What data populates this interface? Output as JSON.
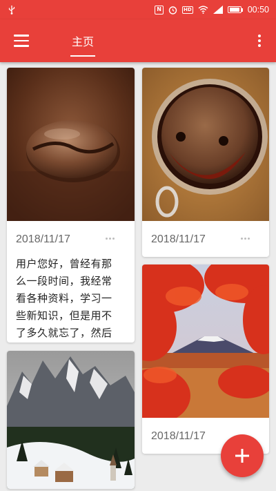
{
  "status_bar": {
    "time": "00:50",
    "icons": [
      "usb-icon",
      "nfc-icon",
      "alarm-icon",
      "hd-icon",
      "wifi-icon",
      "signal-icon",
      "battery-icon"
    ]
  },
  "toolbar": {
    "menu_icon": "hamburger-menu-icon",
    "tab_home": "主页",
    "more_icon": "more-vertical-icon"
  },
  "colors": {
    "primary": "#e8403a",
    "background": "#ececec",
    "card": "#ffffff",
    "date_text": "#666666"
  },
  "cards": [
    {
      "image": "coffee-bean-photo",
      "date": "2018/11/17",
      "more_icon": "more-horizontal-icon",
      "text_lines": [
        "用户您好，曾经有那",
        "么一段时间，我经常",
        "看各种资料，学习一",
        "些新知识，但是用不",
        "了多久就忘了，然后"
      ]
    },
    {
      "image": "coffee-cup-smiley-photo",
      "date": "2018/11/17",
      "more_icon": "more-horizontal-icon"
    },
    {
      "image": "maple-mount-fuji-photo",
      "date": "2018/11/17"
    },
    {
      "image": "snowy-mountain-village-photo"
    }
  ],
  "fab": {
    "icon": "plus-icon"
  }
}
